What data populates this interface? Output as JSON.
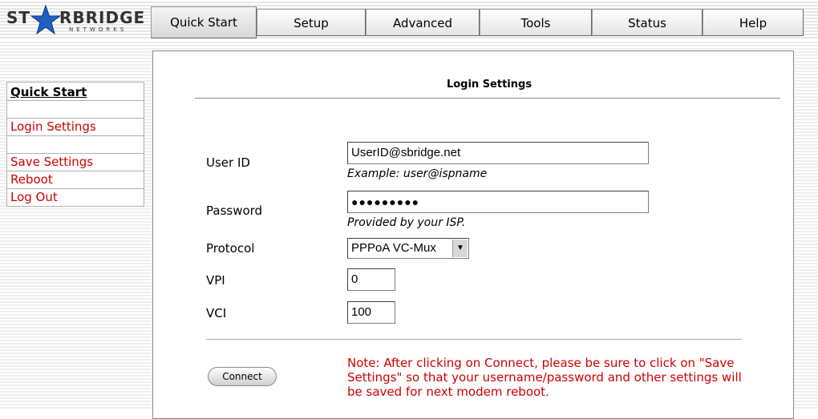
{
  "brand": {
    "left": "ST",
    "right": "RBRIDGE",
    "sub": "NETWORKS"
  },
  "tabs": [
    {
      "label": "Quick Start",
      "active": true
    },
    {
      "label": "Setup"
    },
    {
      "label": "Advanced"
    },
    {
      "label": "Tools"
    },
    {
      "label": "Status"
    },
    {
      "label": "Help"
    }
  ],
  "sidebar": {
    "title": "Quick Start",
    "items": [
      "Login Settings",
      "Save Settings",
      "Reboot",
      "Log Out"
    ]
  },
  "page": {
    "title": "Login Settings",
    "user_id_label": "User ID",
    "user_id_value": "UserID@sbridge.net",
    "user_id_hint": "Example: user@ispname",
    "password_label": "Password",
    "password_value": "●●●●●●●●●",
    "password_hint": "Provided by your ISP.",
    "protocol_label": "Protocol",
    "protocol_value": "PPPoA VC-Mux",
    "vpi_label": "VPI",
    "vpi_value": "0",
    "vci_label": "VCI",
    "vci_value": "100",
    "connect_label": "Connect",
    "note": "Note: After clicking on Connect, please be sure to click on \"Save Settings\" so that your username/password and other settings will be saved for next modem reboot."
  },
  "colors": {
    "note": "#cc0000",
    "sidebar_link": "#cc0000"
  }
}
